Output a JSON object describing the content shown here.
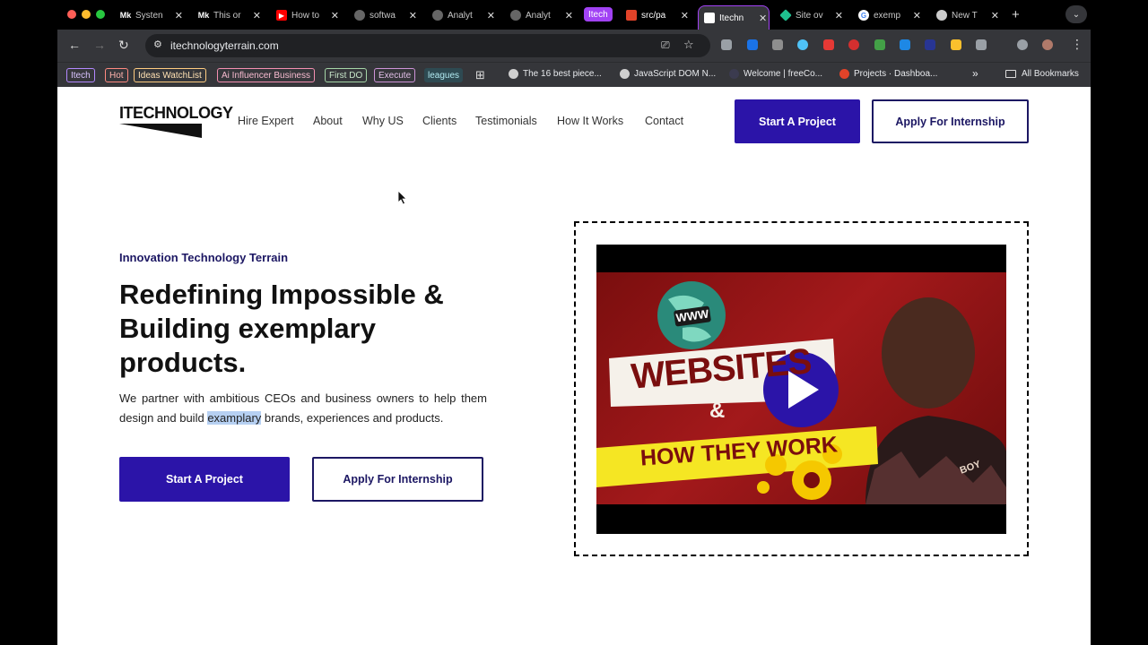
{
  "browser": {
    "tabs": [
      {
        "title": "Systen",
        "favicon": "Mk"
      },
      {
        "title": "This or",
        "favicon": "Mk"
      },
      {
        "title": "How to",
        "favicon": "yt"
      },
      {
        "title": "softwa",
        "favicon": "globe"
      },
      {
        "title": "Analyt",
        "favicon": "globe"
      },
      {
        "title": "Analyt",
        "favicon": "globe"
      },
      {
        "title": "src/pa",
        "favicon": "gitlab",
        "group": "Itech"
      },
      {
        "title": "Itechn",
        "favicon": "page",
        "active": true
      },
      {
        "title": "Site ov",
        "favicon": "diamond"
      },
      {
        "title": "exemp",
        "favicon": "google"
      },
      {
        "title": "New T",
        "favicon": "chrome"
      }
    ],
    "tab_group_label": "Itech",
    "url": "itechnologyterrain.com",
    "bookmark_chips": [
      {
        "label": "Itech",
        "color": "#b388ff"
      },
      {
        "label": "Hot",
        "color": "#ff8a80"
      },
      {
        "label": "Ideas WatchList",
        "color": "#ffcc80"
      },
      {
        "label": "Ai Influencer Business",
        "color": "#f48fb1"
      },
      {
        "label": "First DO",
        "color": "#a5d6a7"
      },
      {
        "label": "Execute",
        "color": "#ce93d8"
      },
      {
        "label": "leagues",
        "color": "#80deea"
      }
    ],
    "bookmarks": [
      "The 16 best piece...",
      "JavaScript DOM N...",
      "Welcome | freeCo...",
      "Projects · Dashboa..."
    ],
    "all_bookmarks": "All Bookmarks",
    "overflow": "»"
  },
  "site": {
    "logo": "ITECHNOLOGY",
    "nav": [
      "Hire Expert",
      "About",
      "Why US",
      "Clients",
      "Testimonials",
      "How It Works",
      "Contact"
    ],
    "header_cta_primary": "Start A Project",
    "header_cta_secondary": "Apply For Internship",
    "eyebrow": "Innovation Technology Terrain",
    "headline": "Redefining Impossible & Building exemplary products.",
    "subtext_before": "We partner with ambitious CEOs and business owners to help them design and build ",
    "subtext_highlight": "examplary",
    "subtext_after": " brands, experiences and products.",
    "cta_primary": "Start A Project",
    "cta_secondary": "Apply For Internship",
    "video": {
      "globe_label": "WWW",
      "title_line1": "WEBSITES",
      "title_amp": "&",
      "title_line2": "HOW THEY WORK",
      "shirt_text": "BOY"
    }
  },
  "colors": {
    "brand_primary": "#2b14a8",
    "brand_text": "#1c1763",
    "highlight": "#b6d0f2",
    "video_red": "#a3191b",
    "video_banner_yellow": "#f5e623"
  }
}
